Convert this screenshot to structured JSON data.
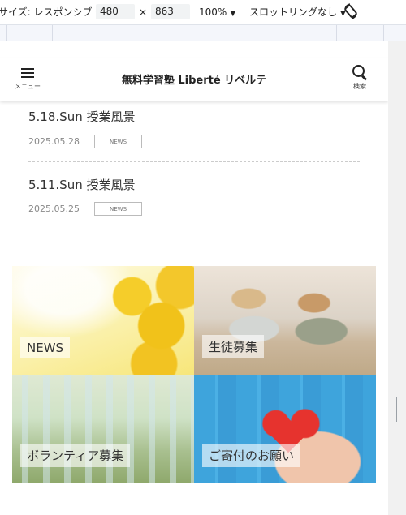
{
  "devtools": {
    "size_label": "サイズ: レスポンシブ",
    "width": "480",
    "times": "×",
    "height": "863",
    "zoom": "100%",
    "throttle": "スロットリングなし"
  },
  "site": {
    "menu_label": "メニュー",
    "title": "無料学習塾 Liberté リベルテ",
    "search_label": "検索"
  },
  "news": [
    {
      "title": "5.18.Sun 授業風景",
      "date": "2025.05.28",
      "tag": "NEWS"
    },
    {
      "title": "5.11.Sun 授業風景",
      "date": "2025.05.25",
      "tag": "NEWS"
    }
  ],
  "tiles": [
    {
      "label": "NEWS"
    },
    {
      "label": "生徒募集"
    },
    {
      "label": "ボランティア募集"
    },
    {
      "label": "ご寄付のお願い"
    }
  ]
}
